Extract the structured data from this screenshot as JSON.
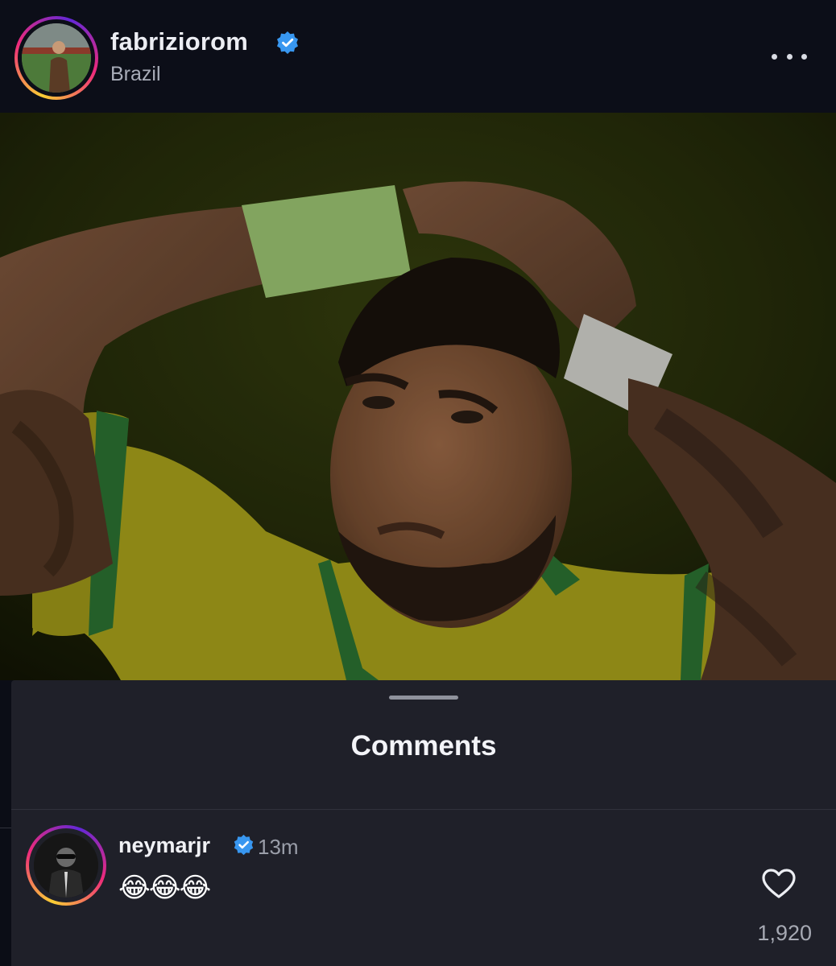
{
  "post": {
    "username": "fabriziorom",
    "location": "Brazil",
    "icons": {
      "verified": "verified-badge-icon",
      "more": "more-options-icon"
    },
    "image": {
      "description_icon": "photo"
    }
  },
  "comments_sheet": {
    "title": "Comments",
    "comments": [
      {
        "username": "neymarjr",
        "time": "13m",
        "text": "😂😂😂",
        "like_count": "1,920"
      }
    ]
  },
  "colors": {
    "background": "#0b0d16",
    "sheet": "#1f2029",
    "verified": "#3897f0",
    "story_ring": [
      "#f9ce34",
      "#ee2a7b",
      "#6228d7"
    ]
  }
}
